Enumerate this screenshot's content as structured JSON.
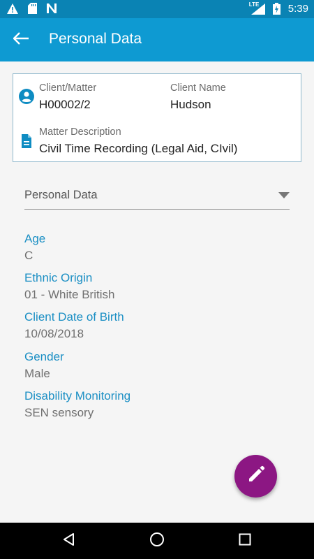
{
  "status_bar": {
    "time": "5:39",
    "network": "LTE",
    "icons": [
      "warning-icon",
      "sd-card-icon",
      "n-notification-icon",
      "signal-icon",
      "battery-icon"
    ]
  },
  "app_bar": {
    "title": "Personal Data",
    "back_icon": "arrow-left-icon"
  },
  "matter_card": {
    "client_matter_label": "Client/Matter",
    "client_matter_value": "H00002/2",
    "client_name_label": "Client Name",
    "client_name_value": "Hudson",
    "matter_description_label": "Matter Description",
    "matter_description_value": "Civil Time Recording (Legal Aid, CIvil)",
    "icons": [
      "account-circle-icon",
      "document-icon"
    ]
  },
  "section_dropdown": {
    "selected": "Personal Data"
  },
  "fields": [
    {
      "label": "Age",
      "value": "C"
    },
    {
      "label": "Ethnic Origin",
      "value": "01 - White British"
    },
    {
      "label": "Client Date of Birth",
      "value": "10/08/2018"
    },
    {
      "label": "Gender",
      "value": "Male"
    },
    {
      "label": "Disability Monitoring",
      "value": "SEN sensory"
    }
  ],
  "fab": {
    "icon": "pencil-icon"
  },
  "nav_bar": {
    "icons": [
      "back-triangle-icon",
      "home-circle-icon",
      "recents-square-icon"
    ]
  },
  "colors": {
    "status_bar": "#0a83b4",
    "app_bar": "#0e9ad2",
    "accent_label": "#1b8fc4",
    "fab": "#8c1783"
  }
}
